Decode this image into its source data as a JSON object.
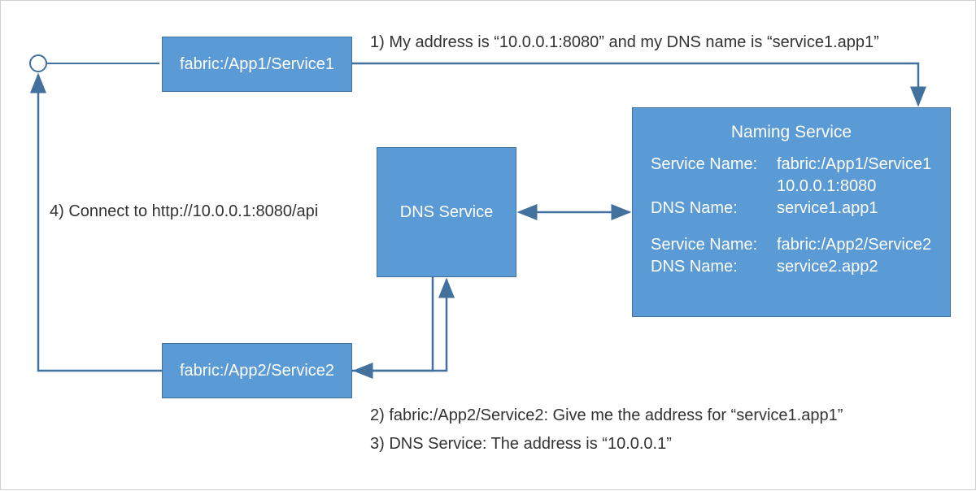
{
  "boxes": {
    "service1": "fabric:/App1/Service1",
    "service2": "fabric:/App2/Service2",
    "dns": "DNS Service"
  },
  "naming": {
    "title": "Naming Service",
    "entry1": {
      "service_name_label": "Service Name:",
      "service_name_value": "fabric:/App1/Service1",
      "address": "10.0.0.1:8080",
      "dns_label": "DNS Name:",
      "dns_value": "service1.app1"
    },
    "entry2": {
      "service_name_label": "Service Name:",
      "service_name_value": "fabric:/App2/Service2",
      "dns_label": "DNS Name:",
      "dns_value": "service2.app2"
    }
  },
  "steps": {
    "s1": "1) My address is “10.0.0.1:8080” and my DNS name is “service1.app1”",
    "s2": "2) fabric:/App2/Service2: Give me the address for “service1.app1”",
    "s3": "3) DNS Service: The address is “10.0.0.1”",
    "s4": "4) Connect to http://10.0.0.1:8080/api"
  },
  "colors": {
    "box_fill": "#5b9bd5",
    "box_border": "#41719c",
    "arrow": "#41719c"
  }
}
